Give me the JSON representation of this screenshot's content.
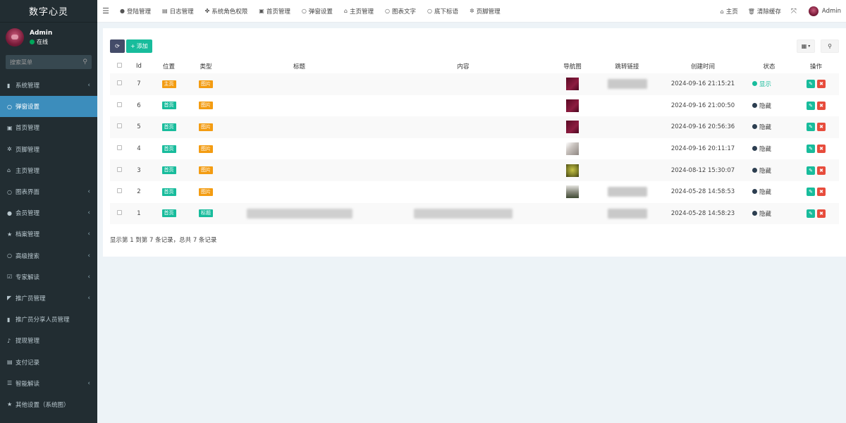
{
  "app": {
    "title": "数字心灵"
  },
  "user": {
    "name": "Admin",
    "status": "在线"
  },
  "sidebar": {
    "search_placeholder": "搜索菜单",
    "items": [
      {
        "label": "系统管理",
        "icon": "bookmark-icon",
        "glyph": "▮",
        "chevron": true
      },
      {
        "label": "弹窗设置",
        "icon": "circle-icon",
        "glyph": "○",
        "chevron": false,
        "active": true
      },
      {
        "label": "首页管理",
        "icon": "image-icon",
        "glyph": "▣",
        "chevron": false
      },
      {
        "label": "页脚管理",
        "icon": "gear-icon",
        "glyph": "✲",
        "chevron": false
      },
      {
        "label": "主页管理",
        "icon": "home-icon",
        "glyph": "⌂",
        "chevron": false
      },
      {
        "label": "图表界面",
        "icon": "circle-icon",
        "glyph": "○",
        "chevron": true
      },
      {
        "label": "会员管理",
        "icon": "user-icon",
        "glyph": "●",
        "chevron": true
      },
      {
        "label": "档案管理",
        "icon": "star-icon",
        "glyph": "★",
        "chevron": true
      },
      {
        "label": "高级搜索",
        "icon": "circle-icon",
        "glyph": "○",
        "chevron": true
      },
      {
        "label": "专家解读",
        "icon": "check-square-icon",
        "glyph": "☑",
        "chevron": true
      },
      {
        "label": "推广员管理",
        "icon": "tag-icon",
        "glyph": "◤",
        "chevron": true
      },
      {
        "label": "推广员分享人员管理",
        "icon": "bookmark-icon",
        "glyph": "▮",
        "chevron": false
      },
      {
        "label": "提现管理",
        "icon": "bell-icon",
        "glyph": "♪",
        "chevron": false
      },
      {
        "label": "支付记录",
        "icon": "file-icon",
        "glyph": "▤",
        "chevron": false
      },
      {
        "label": "智能解读",
        "icon": "list-icon",
        "glyph": "☰",
        "chevron": true
      },
      {
        "label": "其他设置（系统图）",
        "icon": "star-icon",
        "glyph": "★",
        "chevron": false
      },
      {
        "label": "",
        "icon": "circle-icon",
        "glyph": "○",
        "chevron": false
      }
    ]
  },
  "topnav": {
    "tabs": [
      {
        "label": "登陆管理",
        "icon": "user-icon",
        "glyph": "●"
      },
      {
        "label": "日志管理",
        "icon": "list-icon",
        "glyph": "▤"
      },
      {
        "label": "系统角色权限",
        "icon": "users-icon",
        "glyph": "✤"
      },
      {
        "label": "首页管理",
        "icon": "image-icon",
        "glyph": "▣"
      },
      {
        "label": "弹窗设置",
        "icon": "circle-icon",
        "glyph": "○"
      },
      {
        "label": "主页管理",
        "icon": "home-icon",
        "glyph": "⌂"
      },
      {
        "label": "图表文字",
        "icon": "circle-icon",
        "glyph": "○"
      },
      {
        "label": "底下标语",
        "icon": "circle-icon",
        "glyph": "○"
      },
      {
        "label": "页脚管理",
        "icon": "gear-icon",
        "glyph": "✲"
      }
    ],
    "home_label": "主页",
    "clear_cache_label": "清除缓存",
    "admin_label": "Admin"
  },
  "toolbar": {
    "add_label": "添加"
  },
  "table": {
    "headers": [
      "Id",
      "位置",
      "类型",
      "标题",
      "内容",
      "导航图",
      "跳转链接",
      "创建时间",
      "状态",
      "操作"
    ],
    "rows": [
      {
        "id": "7",
        "position": "主页",
        "pos_color": "orange",
        "type": "图片",
        "type_color": "orange",
        "thumb": "maroon",
        "link_blur": true,
        "title_blur": false,
        "content_blur": false,
        "created": "2024-09-16 21:15:21",
        "status": "显示",
        "shown": true
      },
      {
        "id": "6",
        "position": "首页",
        "pos_color": "green",
        "type": "图片",
        "type_color": "orange",
        "thumb": "maroon",
        "link_blur": false,
        "title_blur": false,
        "content_blur": false,
        "created": "2024-09-16 21:00:50",
        "status": "隐藏",
        "shown": false
      },
      {
        "id": "5",
        "position": "首页",
        "pos_color": "green",
        "type": "图片",
        "type_color": "orange",
        "thumb": "maroon",
        "link_blur": false,
        "title_blur": false,
        "content_blur": false,
        "created": "2024-09-16 20:56:36",
        "status": "隐藏",
        "shown": false
      },
      {
        "id": "4",
        "position": "首页",
        "pos_color": "green",
        "type": "图片",
        "type_color": "orange",
        "thumb": "grey",
        "link_blur": false,
        "title_blur": false,
        "content_blur": false,
        "created": "2024-09-16 20:11:17",
        "status": "隐藏",
        "shown": false
      },
      {
        "id": "3",
        "position": "首页",
        "pos_color": "green",
        "type": "图片",
        "type_color": "orange",
        "thumb": "olive",
        "link_blur": false,
        "title_blur": false,
        "content_blur": false,
        "created": "2024-08-12 15:30:07",
        "status": "隐藏",
        "shown": false
      },
      {
        "id": "2",
        "position": "首页",
        "pos_color": "green",
        "type": "图片",
        "type_color": "orange",
        "thumb": "greygreen",
        "link_blur": true,
        "title_blur": false,
        "content_blur": false,
        "created": "2024-05-28 14:58:53",
        "status": "隐藏",
        "shown": false
      },
      {
        "id": "1",
        "position": "首页",
        "pos_color": "green",
        "type": "标题",
        "type_color": "green",
        "thumb": "none",
        "link_blur": true,
        "title_blur": true,
        "content_blur": true,
        "created": "2024-05-28 14:58:23",
        "status": "隐藏",
        "shown": false
      }
    ]
  },
  "footer": {
    "info": "显示第 1 到第 7 条记录，总共 7 条记录"
  },
  "colors": {
    "sidebar_bg": "#222d32",
    "active_menu": "#3c8dbc",
    "success": "#18bc9c",
    "warning": "#f39c12",
    "danger": "#e74c3c",
    "refresh": "#444c69"
  }
}
